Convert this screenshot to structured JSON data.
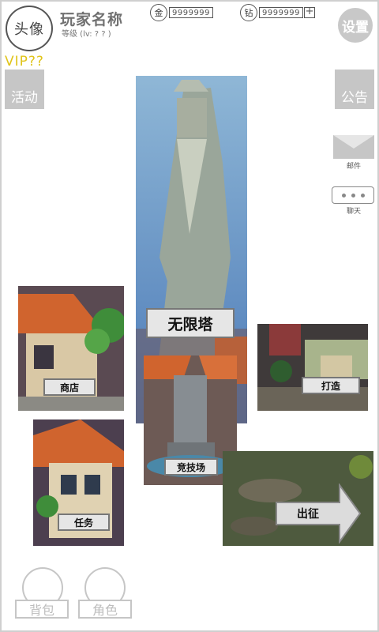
{
  "header": {
    "avatar_label": "头像",
    "player_name": "玩家名称",
    "player_level": "等级 (lv: ? ? )",
    "vip": "VIP??",
    "gold": {
      "icon_label": "金",
      "value": "9999999"
    },
    "diamond": {
      "icon_label": "钻",
      "value": "9999999",
      "add_label": "+"
    },
    "settings_label": "设置"
  },
  "side": {
    "activity_label": "活动",
    "notice_label": "公告",
    "mail_label": "邮件",
    "chat_label": "聊天"
  },
  "scenes": {
    "tower_label": "无限塔",
    "shop_label": "商店",
    "forge_label": "打造",
    "arena_label": "竞技场",
    "quest_label": "任务",
    "expedition_label": "出征"
  },
  "bottom": {
    "bag_label": "背包",
    "role_label": "角色"
  }
}
